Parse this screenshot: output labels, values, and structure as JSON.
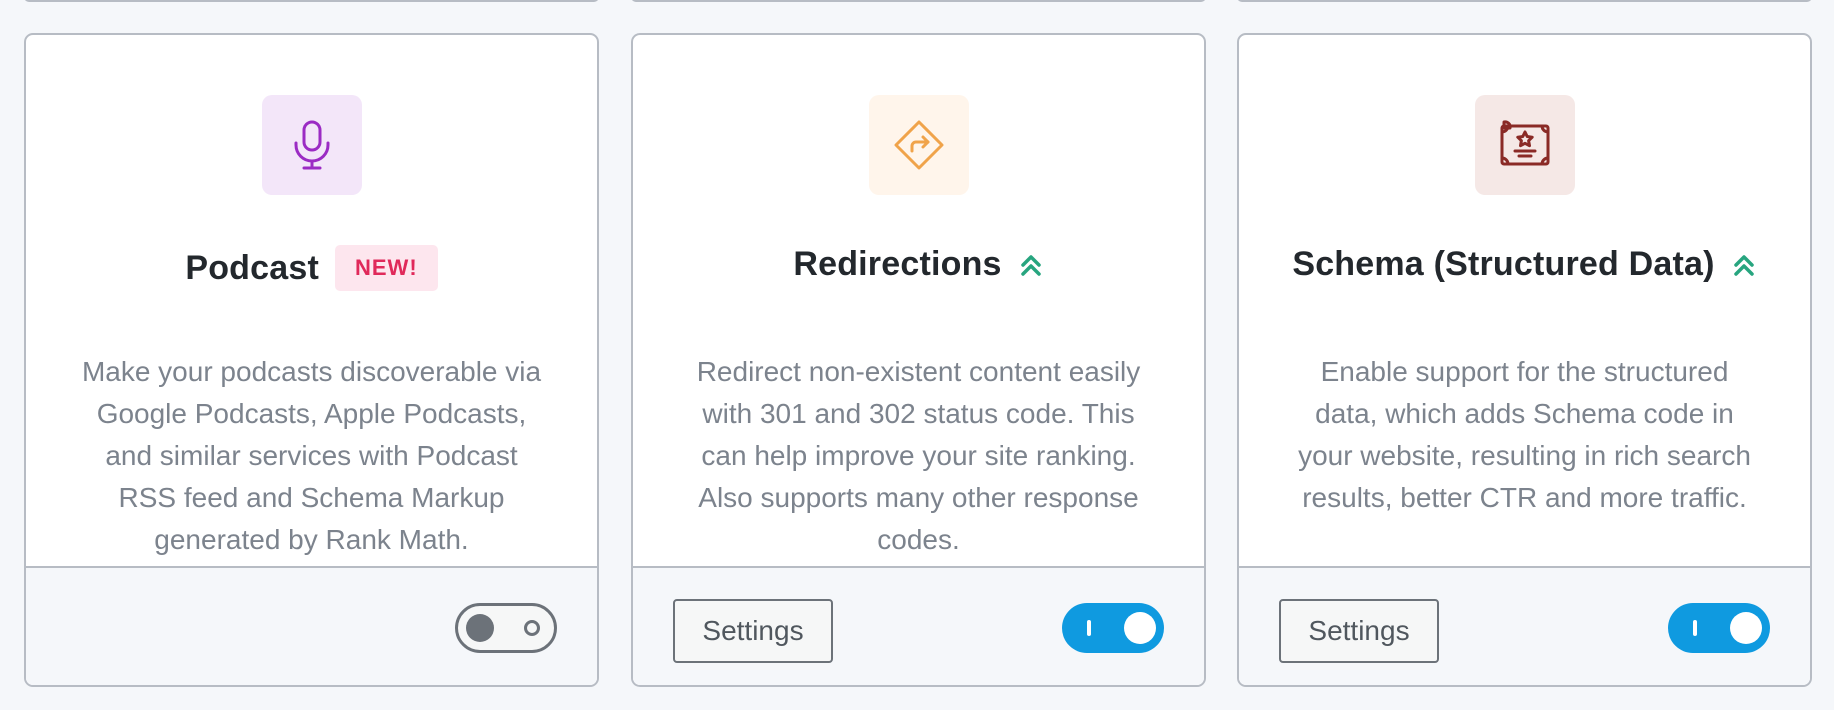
{
  "modules": [
    {
      "title": "Podcast",
      "badge": "NEW!",
      "description": "Make your podcasts discoverable via Google Podcasts, Apple Podcasts, and similar services with Podcast RSS feed and Schema Markup generated by Rank Math.",
      "icon": "microphone-icon",
      "icon_color": "#9b2bc4",
      "icon_bg": "#f3e6f9",
      "has_settings": false,
      "enabled": false
    },
    {
      "title": "Redirections",
      "pro": true,
      "description": "Redirect non-existent content easily with 301 and 302 status code. This can help improve your site ranking. Also supports many other response codes.",
      "icon": "redirect-sign-icon",
      "icon_color": "#f0a34a",
      "icon_bg": "#fff5eb",
      "settings_label": "Settings",
      "has_settings": true,
      "enabled": true
    },
    {
      "title": "Schema (Structured Data)",
      "pro": true,
      "description": "Enable support for the structured data, which adds Schema code in your website, resulting in rich search results, better CTR and more traffic.",
      "icon": "certificate-icon",
      "icon_color": "#8a2a26",
      "icon_bg": "#f5e8e6",
      "settings_label": "Settings",
      "has_settings": true,
      "enabled": true
    }
  ],
  "colors": {
    "toggle_on": "#0f9ae0",
    "toggle_off": "#6c7279",
    "pro_icon": "#27a57f",
    "badge_text": "#e0295a",
    "badge_bg": "#fde6ee"
  }
}
